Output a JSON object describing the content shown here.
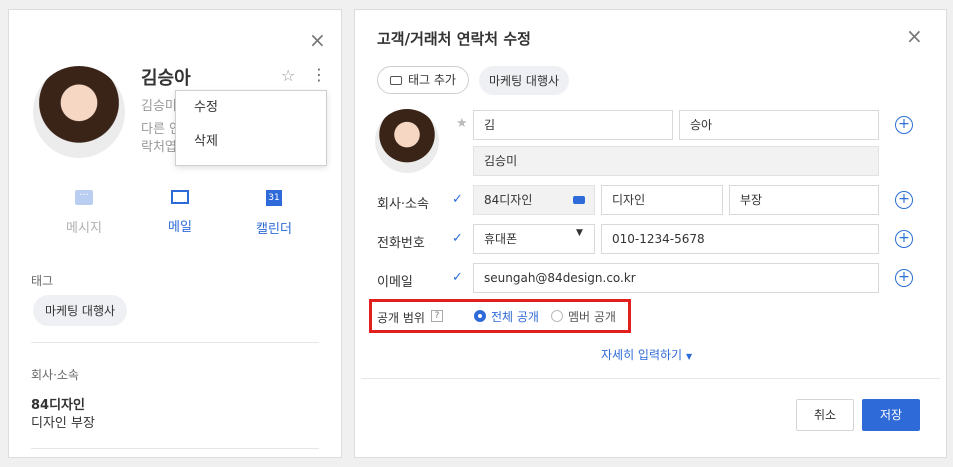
{
  "profile": {
    "close_icon": "×",
    "name": "김승아",
    "star_icon": "☆",
    "more_icon": "⋮",
    "subtitle_lines": [
      "김승미",
      "다른 연",
      "락처엽"
    ],
    "menu": {
      "edit": "수정",
      "delete": "삭제"
    },
    "actions": {
      "message": "메시지",
      "mail": "메일",
      "calendar": "캘린더",
      "calendar_day": "31"
    },
    "tags_label": "태그",
    "tag": "마케팅 대행사",
    "company_label": "회사·소속",
    "company": "84디자인",
    "dept_position": "디자인 부장",
    "colors": {
      "accent": "#2f6bd8",
      "disabled_icon": "#b9cef0"
    }
  },
  "editor": {
    "title": "고객/거래처 연락처 수정",
    "close_icon": "×",
    "add_tag": "태그 추가",
    "tag": "마케팅 대행사",
    "last_name": "김",
    "first_name": "승아",
    "display_name": "김승미",
    "company_label": "회사·소속",
    "company": "84디자인",
    "department": "디자인",
    "position": "부장",
    "phone_label": "전화번호",
    "phone_type": "휴대폰",
    "phone": "010-1234-5678",
    "email_label": "이메일",
    "email": "seungah@84design.co.kr",
    "visibility_label": "공개 범위",
    "visibility_help": "?",
    "visibility_all": "전체 공개",
    "visibility_members": "멤버 공개",
    "more_details": "자세히 입력하기",
    "cancel": "취소",
    "save": "저장",
    "highlight_color": "#e0201e"
  }
}
